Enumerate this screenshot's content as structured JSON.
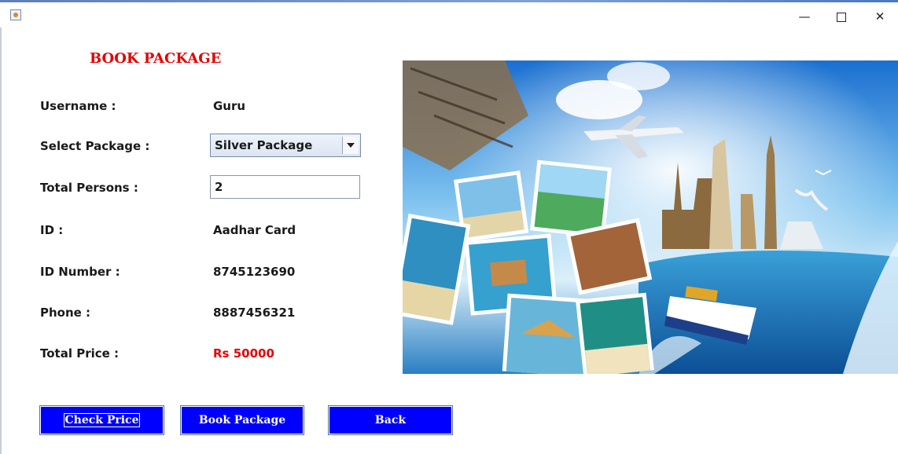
{
  "window": {
    "minimize_glyph": "—",
    "close_glyph": "✕"
  },
  "heading": "BOOK PACKAGE",
  "form": {
    "username": {
      "label": "Username :",
      "value": "Guru"
    },
    "package": {
      "label": "Select Package :",
      "selected": "Silver Package"
    },
    "persons": {
      "label": "Total Persons :",
      "value": "2"
    },
    "id": {
      "label": "ID :",
      "value": "Aadhar Card"
    },
    "id_number": {
      "label": "ID Number :",
      "value": "8745123690"
    },
    "phone": {
      "label": "Phone :",
      "value": "8887456321"
    },
    "total_price": {
      "label": "Total Price :",
      "value": "Rs 50000"
    }
  },
  "buttons": {
    "check_price": "Check Price",
    "book_package": "Book Package",
    "back": "Back"
  },
  "colors": {
    "accent_red": "#e60000",
    "button_blue": "#0000ff"
  },
  "icons": {
    "app": "java-icon",
    "minimize": "minimize-icon",
    "maximize": "maximize-icon",
    "close": "close-icon"
  }
}
